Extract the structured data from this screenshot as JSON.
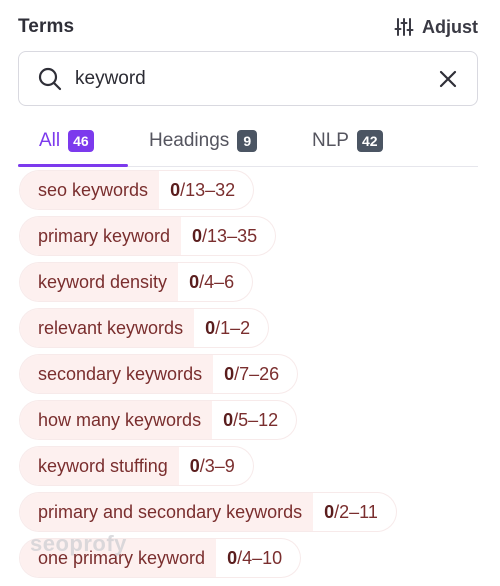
{
  "header": {
    "title": "Terms",
    "adjust_label": "Adjust",
    "adjust_icon": "sliders-icon"
  },
  "search": {
    "value": "keyword",
    "placeholder": "",
    "search_icon": "search-icon",
    "clear_icon": "close-icon"
  },
  "tabs": [
    {
      "label": "All",
      "count": "46",
      "active": true
    },
    {
      "label": "Headings",
      "count": "9",
      "active": false
    },
    {
      "label": "NLP",
      "count": "42",
      "active": false
    }
  ],
  "terms": [
    {
      "name": "seo keywords",
      "used": "0",
      "range": "/13–32"
    },
    {
      "name": "primary keyword",
      "used": "0",
      "range": "/13–35"
    },
    {
      "name": "keyword density",
      "used": "0",
      "range": "/4–6"
    },
    {
      "name": "relevant keywords",
      "used": "0",
      "range": "/1–2"
    },
    {
      "name": "secondary keywords",
      "used": "0",
      "range": "/7–26"
    },
    {
      "name": "how many keywords",
      "used": "0",
      "range": "/5–12"
    },
    {
      "name": "keyword stuffing",
      "used": "0",
      "range": "/3–9"
    },
    {
      "name": "primary and secondary keywords",
      "used": "0",
      "range": "/2–11"
    },
    {
      "name": "one primary keyword",
      "used": "0",
      "range": "/4–10"
    }
  ],
  "watermark": "seoprofy",
  "colors": {
    "accent": "#7c3aed",
    "chip_bg": "#fdf0ef",
    "chip_text": "#7a2e2e",
    "badge_dark": "#4b5563"
  }
}
